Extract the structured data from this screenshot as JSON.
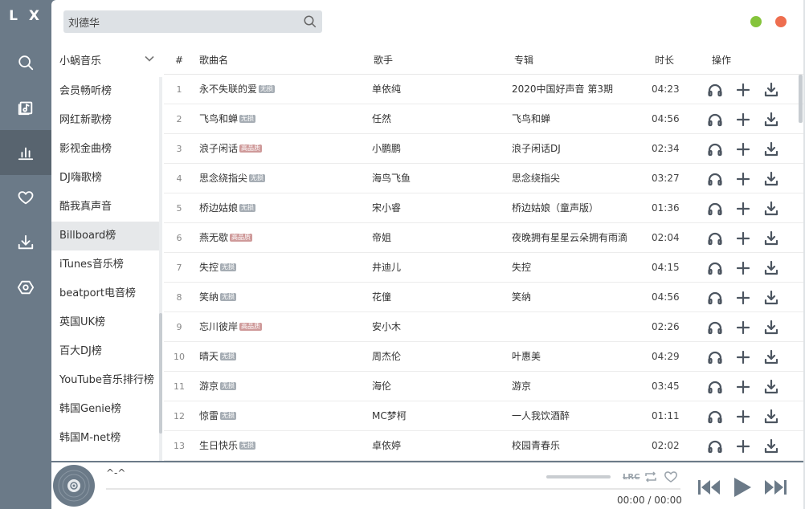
{
  "app": {
    "logo": "L X"
  },
  "nav": {
    "items": [
      {
        "name": "search",
        "active": false
      },
      {
        "name": "song-list",
        "active": false
      },
      {
        "name": "leaderboard",
        "active": true
      },
      {
        "name": "favorite",
        "active": false
      },
      {
        "name": "download",
        "active": false
      },
      {
        "name": "settings",
        "active": false
      }
    ]
  },
  "search": {
    "value": "刘德华"
  },
  "source": {
    "selected": "小蜗音乐"
  },
  "boards": [
    "会员畅听榜",
    "网红新歌榜",
    "影视金曲榜",
    "DJ嗨歌榜",
    "酷我真声音",
    "Billboard榜",
    "iTunes音乐榜",
    "beatport电音榜",
    "英国UK榜",
    "百大DJ榜",
    "YouTube音乐排行榜",
    "韩国Genie榜",
    "韩国M-net榜"
  ],
  "active_board": 5,
  "columns": {
    "num": "#",
    "title": "歌曲名",
    "singer": "歌手",
    "album": "专辑",
    "duration": "时长",
    "ops": "操作"
  },
  "tags": {
    "lossless": "无损",
    "hq": "高品质"
  },
  "songs": [
    {
      "num": "1",
      "title": "永不失联的爱",
      "tag": "无损",
      "tag_type": "lossless",
      "singer": "单依纯",
      "album": "2020中国好声音 第3期",
      "duration": "04:23"
    },
    {
      "num": "2",
      "title": "飞鸟和蝉",
      "tag": "无损",
      "tag_type": "lossless",
      "singer": "任然",
      "album": "飞鸟和蝉",
      "duration": "04:56"
    },
    {
      "num": "3",
      "title": "浪子闲话",
      "tag": "高品质",
      "tag_type": "hq",
      "singer": "小鹏鹏",
      "album": "浪子闲话DJ",
      "duration": "02:34"
    },
    {
      "num": "4",
      "title": "思念绕指尖",
      "tag": "无损",
      "tag_type": "lossless",
      "singer": "海鸟飞鱼",
      "album": "思念绕指尖",
      "duration": "03:27"
    },
    {
      "num": "5",
      "title": "桥边姑娘",
      "tag": "无损",
      "tag_type": "lossless",
      "singer": "宋小睿",
      "album": "桥边姑娘（童声版）",
      "duration": "01:36"
    },
    {
      "num": "6",
      "title": "燕无歇",
      "tag": "高品质",
      "tag_type": "hq",
      "singer": "帝姐",
      "album": "夜晚拥有星星云朵拥有雨滴",
      "duration": "02:04"
    },
    {
      "num": "7",
      "title": "失控",
      "tag": "无损",
      "tag_type": "lossless",
      "singer": "井迪儿",
      "album": "失控",
      "duration": "04:15"
    },
    {
      "num": "8",
      "title": "笑纳",
      "tag": "无损",
      "tag_type": "lossless",
      "singer": "花僮",
      "album": "笑纳",
      "duration": "04:56"
    },
    {
      "num": "9",
      "title": "忘川彼岸",
      "tag": "高品质",
      "tag_type": "hq",
      "singer": "安小木",
      "album": "",
      "duration": "02:26"
    },
    {
      "num": "10",
      "title": "晴天",
      "tag": "无损",
      "tag_type": "lossless",
      "singer": "周杰伦",
      "album": "叶惠美",
      "duration": "04:29"
    },
    {
      "num": "11",
      "title": "游京",
      "tag": "无损",
      "tag_type": "lossless",
      "singer": "海伦",
      "album": "游京",
      "duration": "03:45"
    },
    {
      "num": "12",
      "title": "惊雷",
      "tag": "无损",
      "tag_type": "lossless",
      "singer": "MC梦柯",
      "album": "一人我饮酒醉",
      "duration": "01:11"
    },
    {
      "num": "13",
      "title": "生日快乐",
      "tag": "无损",
      "tag_type": "lossless",
      "singer": "卓依婷",
      "album": "校园青春乐",
      "duration": "02:02"
    }
  ],
  "player": {
    "title": "^-^",
    "lrc_label": "LRC",
    "current_time": "00:00",
    "separator": " / ",
    "total_time": "00:00",
    "progress": 0
  },
  "colors": {
    "sidebar": "#6b7a88",
    "minimize": "#85c43b",
    "close": "#ee6e4f"
  }
}
